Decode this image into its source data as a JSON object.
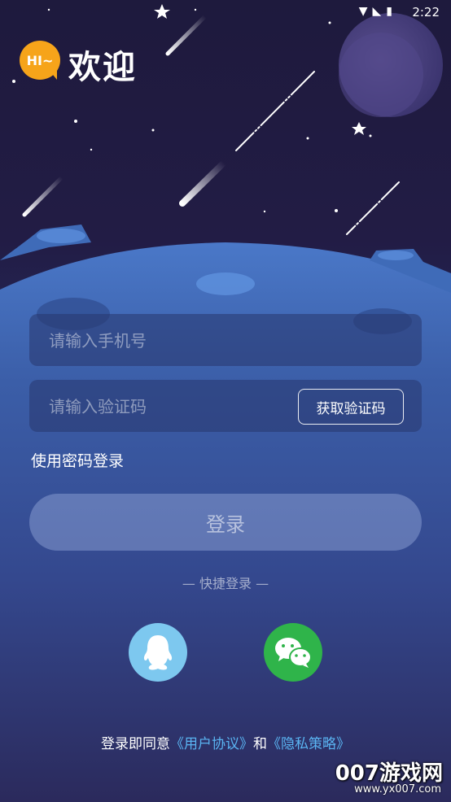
{
  "status_bar": {
    "time": "2:22",
    "icons": [
      "wifi-icon",
      "no-signal-icon",
      "battery-icon"
    ]
  },
  "header": {
    "logo_text": "HI~",
    "title": "欢迎"
  },
  "form": {
    "phone_placeholder": "请输入手机号",
    "code_placeholder": "请输入验证码",
    "get_code_label": "获取验证码",
    "password_login_label": "使用密码登录",
    "login_button_label": "登录"
  },
  "quick_login": {
    "label": "— 快捷登录 —",
    "options": [
      "qq-icon",
      "wechat-icon"
    ]
  },
  "agreement": {
    "prefix": "登录即同意",
    "user_agreement": "《用户协议》",
    "and": "和",
    "privacy_policy": "《隐私策略》"
  },
  "watermark": {
    "brand": "007游戏网",
    "url": "www.yx007.com"
  },
  "colors": {
    "logo": "#f6a41a",
    "link": "#5ab4f2",
    "qq": "#7dc8ef",
    "wechat": "#2fb44a"
  }
}
